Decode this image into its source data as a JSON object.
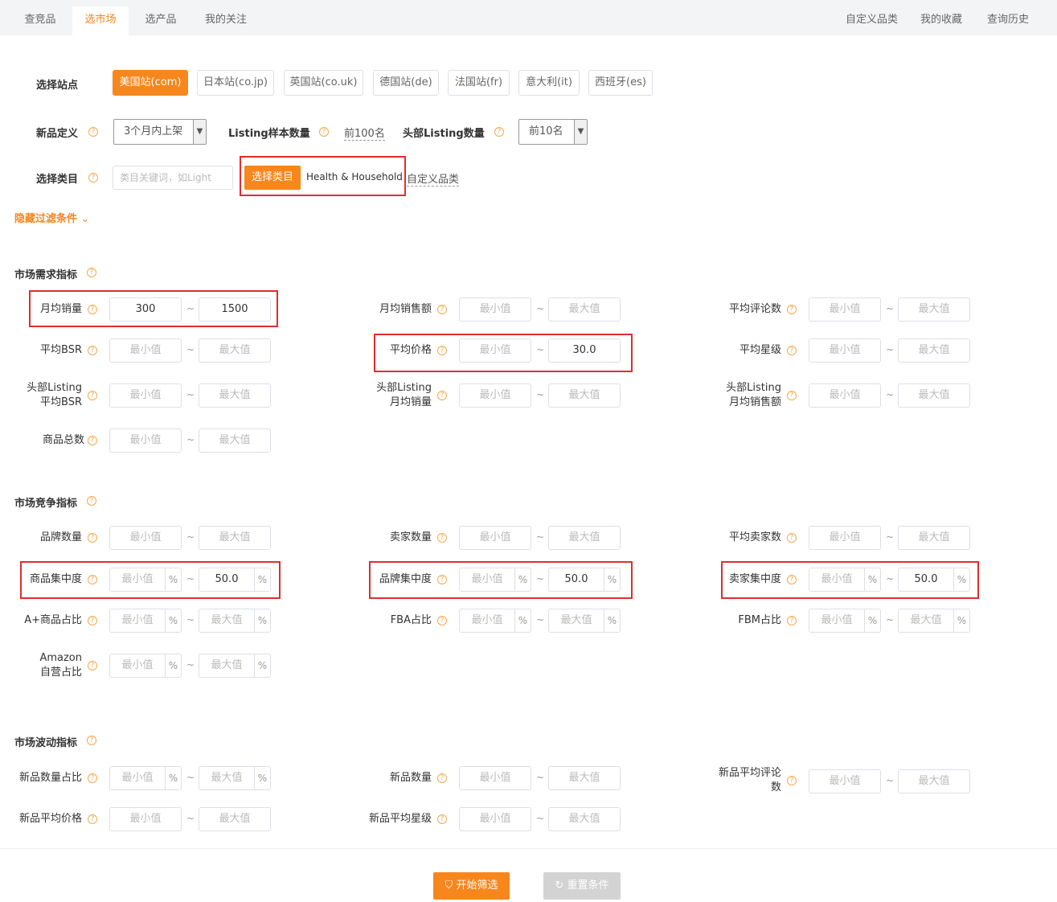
{
  "tabs": [
    {
      "label": "查竞品"
    },
    {
      "label": "选市场"
    },
    {
      "label": "选产品"
    },
    {
      "label": "我的关注"
    }
  ],
  "right_links": [
    {
      "label": "自定义品类"
    },
    {
      "label": "我的收藏"
    },
    {
      "label": "查询历史"
    }
  ],
  "site": {
    "label": "选择站点",
    "options": [
      "美国站(com)",
      "日本站(co.jp)",
      "英国站(co.uk)",
      "德国站(de)",
      "法国站(fr)",
      "意大利(it)",
      "西班牙(es)"
    ],
    "selected": "美国站(com)"
  },
  "new_product": {
    "label": "新品定义",
    "value": "3个月内上架",
    "sample_label": "Listing样本数量",
    "sample_value": "前100名",
    "top_label": "头部Listing数量",
    "top_value": "前10名"
  },
  "category": {
    "label": "选择类目",
    "placeholder": "类目关键词，如Light",
    "button": "选择类目",
    "selected": "Health & Household",
    "custom": "自定义品类"
  },
  "hide_filters": "隐藏过滤条件",
  "placeholders": {
    "min": "最小值",
    "max": "最大值"
  },
  "unit_pct": "%",
  "sections": {
    "demand": "市场需求指标",
    "competition": "市场竞争指标",
    "volatility": "市场波动指标"
  },
  "demand": {
    "monthly_sales": {
      "label": "月均销量",
      "min": "300",
      "max": "1500"
    },
    "monthly_revenue": {
      "label": "月均销售额",
      "min": "",
      "max": ""
    },
    "avg_reviews": {
      "label": "平均评论数",
      "min": "",
      "max": ""
    },
    "avg_bsr": {
      "label": "平均BSR",
      "min": "",
      "max": ""
    },
    "avg_price": {
      "label": "平均价格",
      "min": "",
      "max": "30.0"
    },
    "avg_rating": {
      "label": "平均星级",
      "min": "",
      "max": ""
    },
    "top_bsr": {
      "label1": "头部Listing",
      "label2": "平均BSR",
      "min": "",
      "max": ""
    },
    "top_sales": {
      "label1": "头部Listing",
      "label2": "月均销量",
      "min": "",
      "max": ""
    },
    "top_revenue": {
      "label1": "头部Listing",
      "label2": "月均销售额",
      "min": "",
      "max": ""
    },
    "total_products": {
      "label": "商品总数",
      "min": "",
      "max": ""
    }
  },
  "competition": {
    "brand_count": {
      "label": "品牌数量",
      "min": "",
      "max": ""
    },
    "seller_count": {
      "label": "卖家数量",
      "min": "",
      "max": ""
    },
    "avg_sellers": {
      "label": "平均卖家数",
      "min": "",
      "max": ""
    },
    "product_conc": {
      "label": "商品集中度",
      "min": "",
      "max": "50.0"
    },
    "brand_conc": {
      "label": "品牌集中度",
      "min": "",
      "max": "50.0"
    },
    "seller_conc": {
      "label": "卖家集中度",
      "min": "",
      "max": "50.0"
    },
    "aplus_ratio": {
      "label": "A+商品占比",
      "min": "",
      "max": ""
    },
    "fba_ratio": {
      "label": "FBA占比",
      "min": "",
      "max": ""
    },
    "fbm_ratio": {
      "label": "FBM占比",
      "min": "",
      "max": ""
    },
    "amazon_ratio": {
      "label1": "Amazon",
      "label2": "自营占比",
      "min": "",
      "max": ""
    }
  },
  "volatility": {
    "new_ratio": {
      "label": "新品数量占比",
      "min": "",
      "max": ""
    },
    "new_count": {
      "label": "新品数量",
      "min": "",
      "max": ""
    },
    "new_reviews": {
      "label1": "新品平均评论",
      "label2": "数",
      "min": "",
      "max": ""
    },
    "new_price": {
      "label": "新品平均价格",
      "min": "",
      "max": ""
    },
    "new_rating": {
      "label": "新品平均星级",
      "min": "",
      "max": ""
    }
  },
  "buttons": {
    "start": "开始筛选",
    "reset": "重置条件"
  }
}
